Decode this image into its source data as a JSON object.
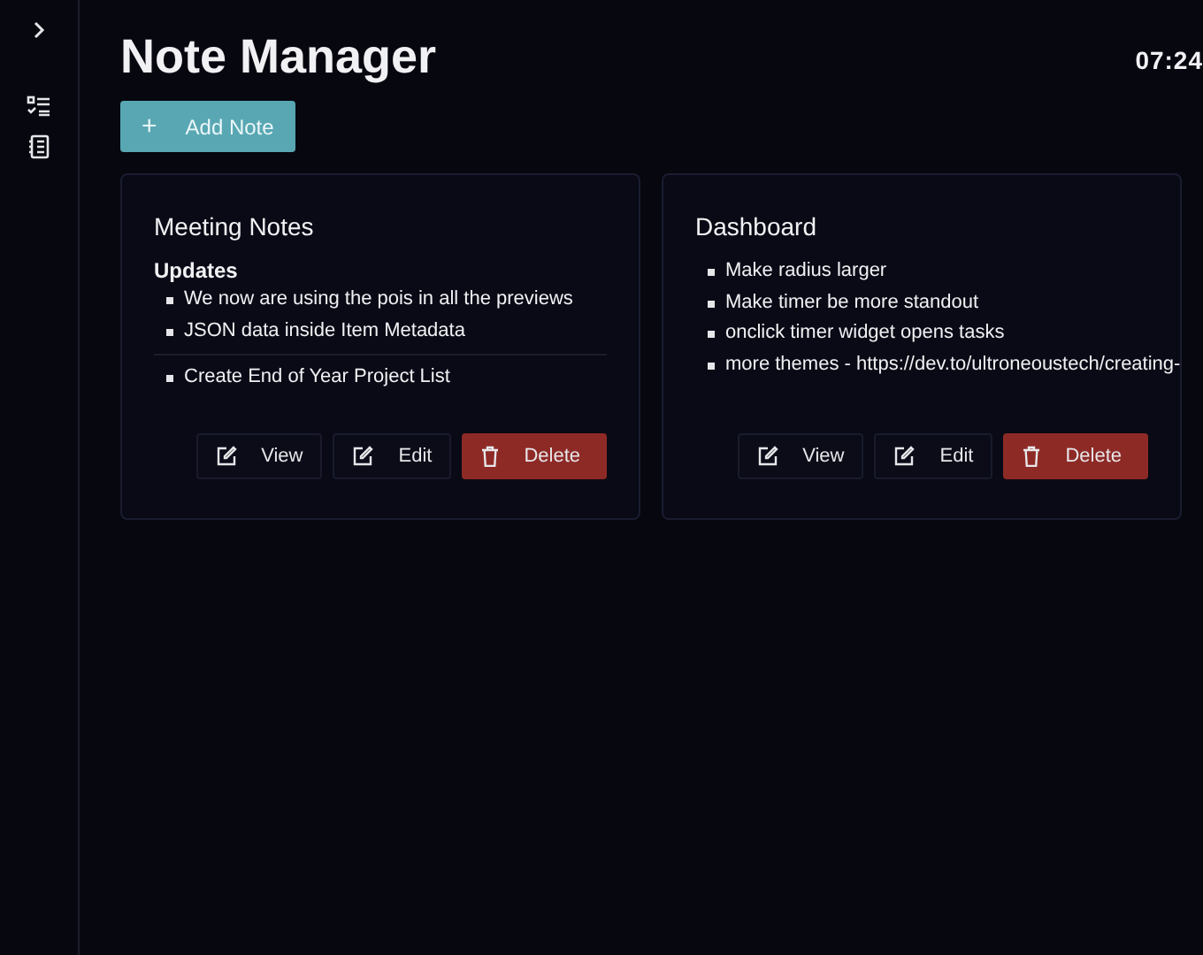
{
  "sidebar": {
    "items": [
      {
        "kind": "toggle"
      },
      {
        "kind": "tasks"
      },
      {
        "kind": "notes"
      }
    ]
  },
  "header": {
    "title": "Note Manager",
    "clock": "07:24"
  },
  "add_button": {
    "icon": "+",
    "label": "Add Note"
  },
  "notes": [
    {
      "title": "Meeting Notes",
      "sections": [
        {
          "heading": "Updates",
          "items": [
            "We now are using the pois in all the previews",
            "JSON data inside Item Metadata"
          ]
        },
        {
          "items": [
            "Create End of Year Project List"
          ]
        }
      ],
      "actions": [
        {
          "kind": "view",
          "label": "View"
        },
        {
          "kind": "edit",
          "label": "Edit"
        },
        {
          "kind": "delete",
          "label": "Delete"
        }
      ]
    },
    {
      "title": "Dashboard",
      "sections": [
        {
          "items": [
            "Make radius larger",
            "Make timer be more standout",
            "onclick timer widget opens tasks",
            "more themes - https://dev.to/ultroneoustech/creating-"
          ]
        }
      ],
      "actions": [
        {
          "kind": "view",
          "label": "View"
        },
        {
          "kind": "edit",
          "label": "Edit"
        },
        {
          "kind": "delete",
          "label": "Delete"
        }
      ]
    }
  ]
}
